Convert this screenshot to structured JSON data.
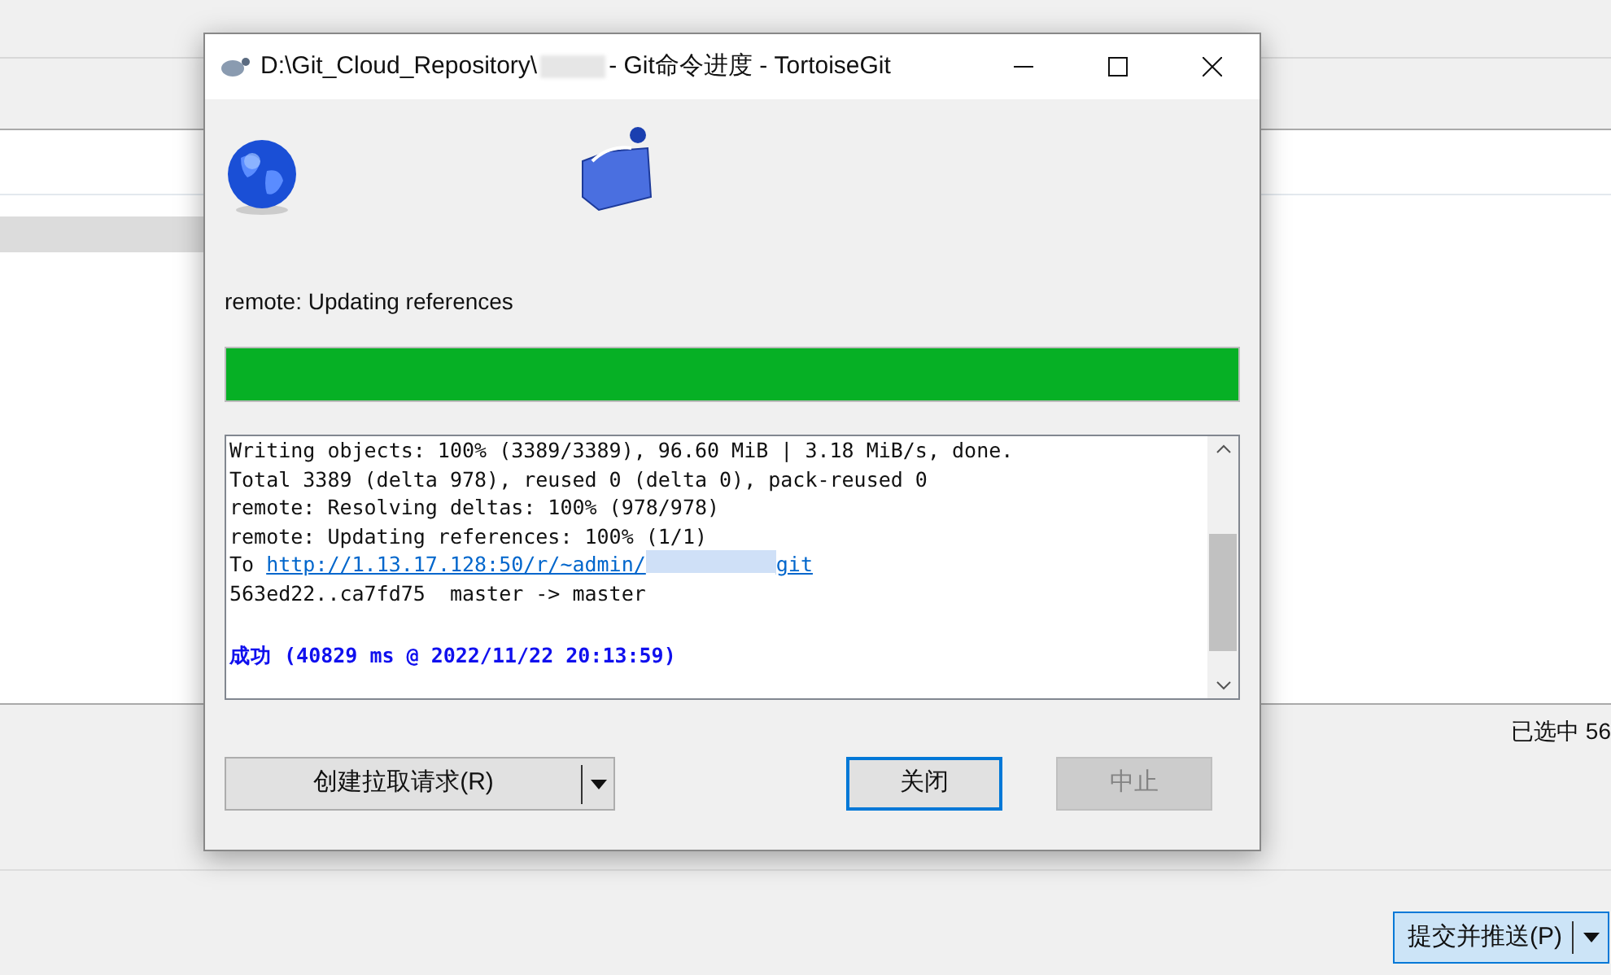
{
  "background": {
    "status_text": "已选中 56",
    "commit_button": {
      "label": "提交并推送(P)"
    }
  },
  "dialog": {
    "title_prefix": "D:\\Git_Cloud_Repository\\",
    "title_suffix": "- Git命令进度 - TortoiseGit",
    "status": "remote: Updating references",
    "progress": {
      "level": 1
    },
    "log": [
      {
        "kind": "text",
        "text": "Writing objects: 100% (3389/3389), 96.60 MiB | 3.18 MiB/s, done."
      },
      {
        "kind": "text",
        "text": "Total 3389 (delta 978), reused 0 (delta 0), pack-reused 0"
      },
      {
        "kind": "text",
        "text": "remote: Resolving deltas: 100% (978/978)"
      },
      {
        "kind": "text",
        "text": "remote: Updating references: 100% (1/1)"
      },
      {
        "kind": "link",
        "text": "To",
        "link_prefix": "http://1.13.17.128:50/r/~admin/",
        "link_suffix": "git"
      },
      {
        "kind": "text",
        "text": "563ed22..ca7fd75  master -> master"
      },
      {
        "kind": "blank"
      },
      {
        "kind": "success",
        "text": "成功 (40829 ms @ 2022/11/22 20:13:59)"
      }
    ],
    "buttons": [
      {
        "label": "创建拉取请求(R)",
        "kind": "split",
        "disabled": false
      },
      {
        "label": "关闭",
        "kind": "default",
        "disabled": false
      },
      {
        "label": "中止",
        "kind": "plain",
        "disabled": true
      }
    ]
  }
}
